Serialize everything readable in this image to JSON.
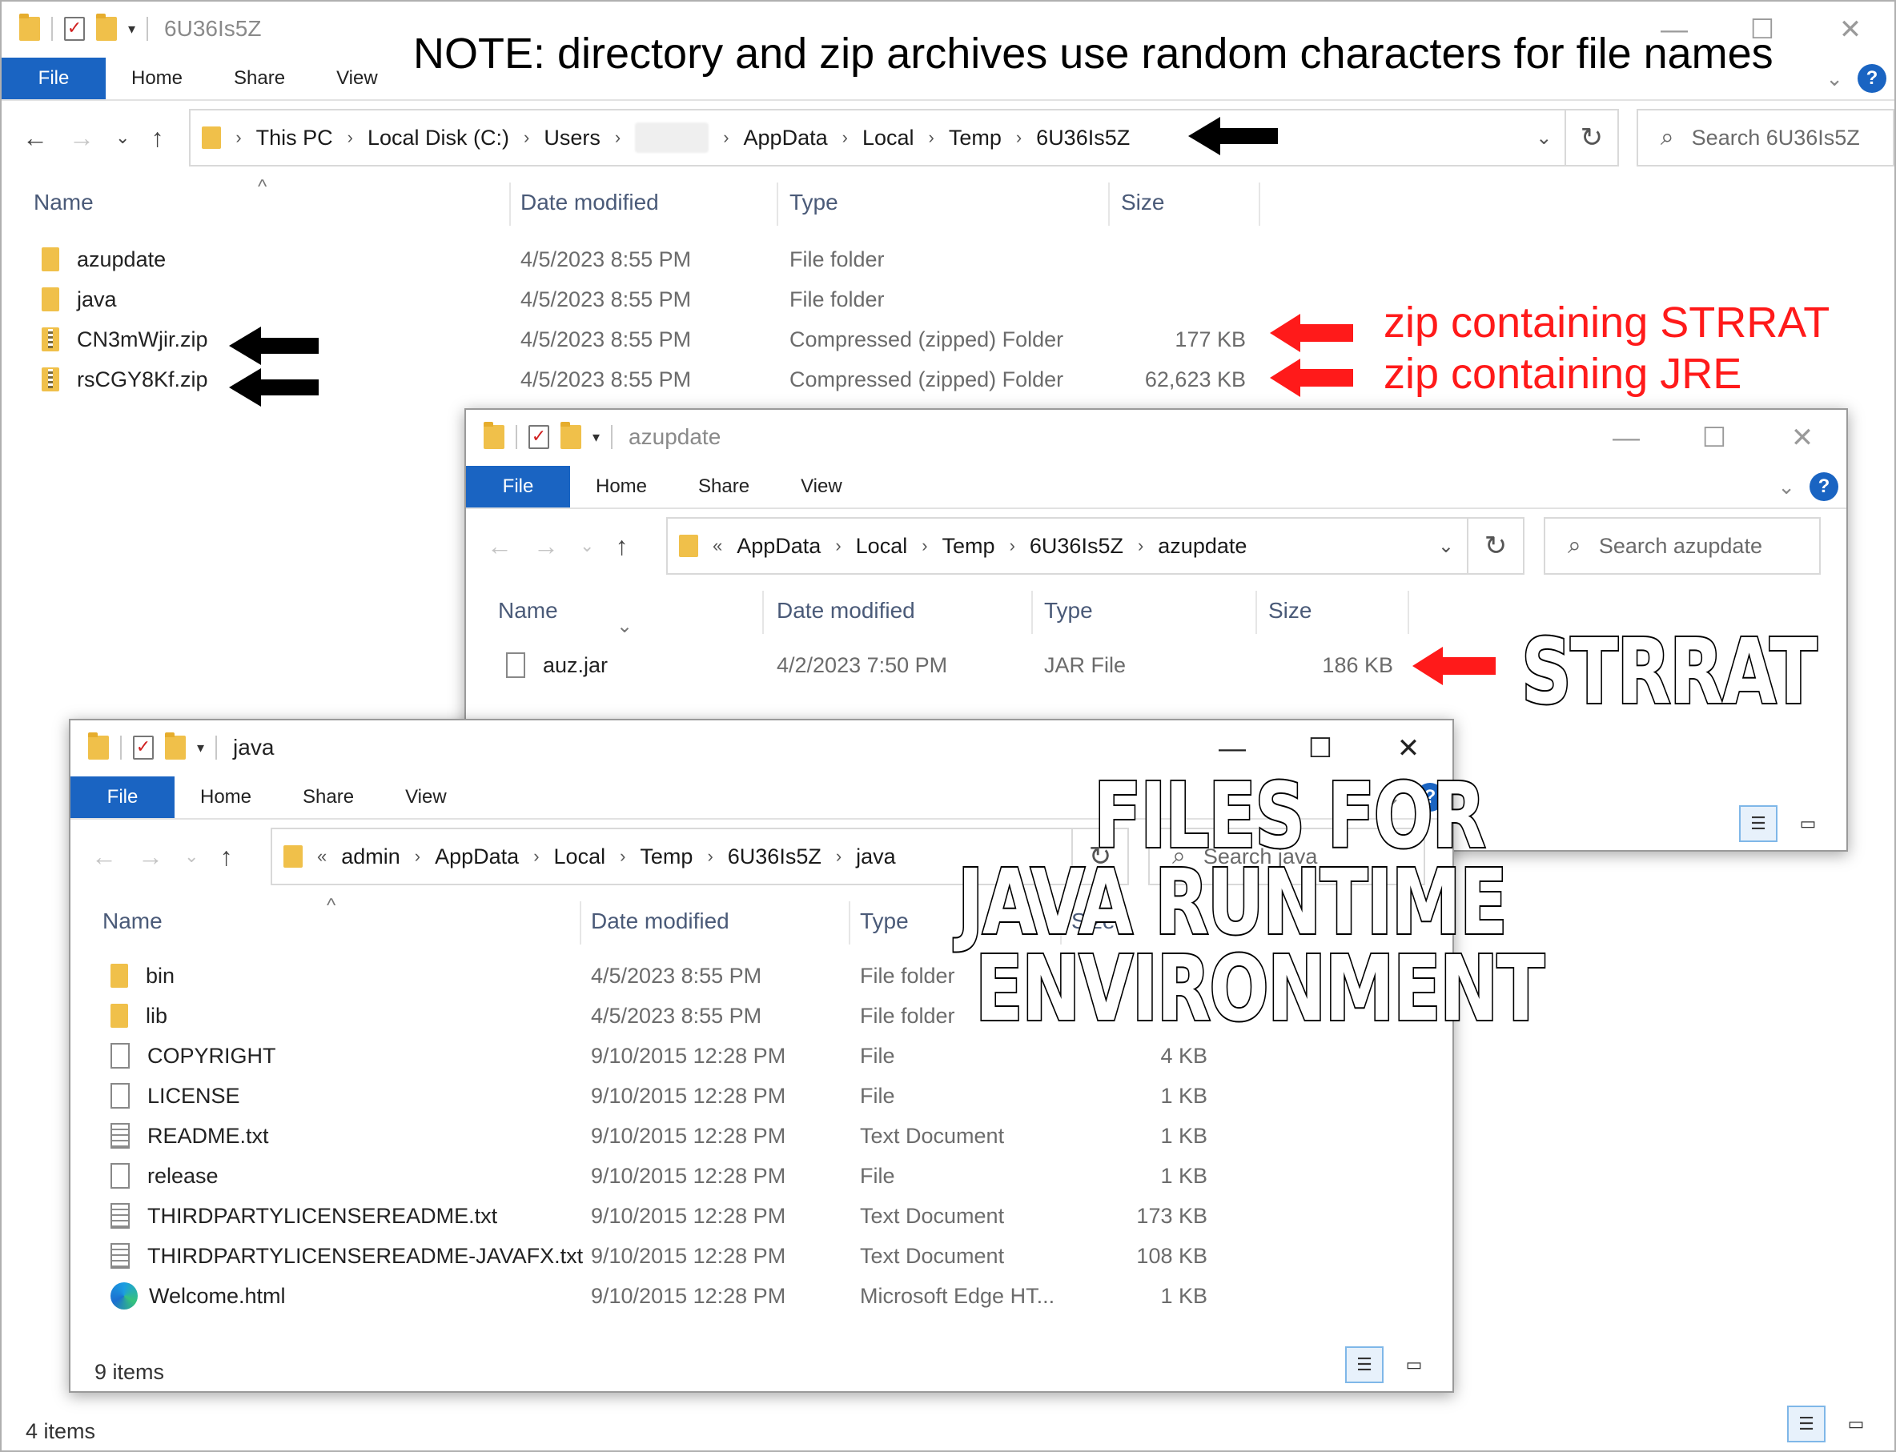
{
  "main": {
    "title": "6U36Is5Z",
    "tabs": [
      "File",
      "Home",
      "Share",
      "View"
    ],
    "breadcrumb": [
      "This PC",
      "Local Disk (C:)",
      "Users",
      "AppData",
      "Local",
      "Temp",
      "6U36Is5Z"
    ],
    "search_placeholder": "Search 6U36Is5Z",
    "columns": [
      "Name",
      "Date modified",
      "Type",
      "Size"
    ],
    "rows": [
      {
        "name": "azupdate",
        "date": "4/5/2023 8:55 PM",
        "type": "File folder",
        "size": ""
      },
      {
        "name": "java",
        "date": "4/5/2023 8:55 PM",
        "type": "File folder",
        "size": ""
      },
      {
        "name": "CN3mWjir.zip",
        "date": "4/5/2023 8:55 PM",
        "type": "Compressed (zipped) Folder",
        "size": "177 KB"
      },
      {
        "name": "rsCGY8Kf.zip",
        "date": "4/5/2023 8:55 PM",
        "type": "Compressed (zipped) Folder",
        "size": "62,623 KB"
      }
    ],
    "status": "4 items"
  },
  "azupdate": {
    "title": "azupdate",
    "tabs": [
      "File",
      "Home",
      "Share",
      "View"
    ],
    "breadcrumb_prefix": "«",
    "breadcrumb": [
      "AppData",
      "Local",
      "Temp",
      "6U36Is5Z",
      "azupdate"
    ],
    "search_placeholder": "Search azupdate",
    "columns": [
      "Name",
      "Date modified",
      "Type",
      "Size"
    ],
    "rows": [
      {
        "name": "auz.jar",
        "date": "4/2/2023 7:50 PM",
        "type": "JAR File",
        "size": "186 KB"
      }
    ]
  },
  "java": {
    "title": "java",
    "tabs": [
      "File",
      "Home",
      "Share",
      "View"
    ],
    "breadcrumb_prefix": "«",
    "breadcrumb": [
      "admin",
      "AppData",
      "Local",
      "Temp",
      "6U36Is5Z",
      "java"
    ],
    "search_placeholder": "Search java",
    "columns": [
      "Name",
      "Date modified",
      "Type",
      "Size"
    ],
    "rows": [
      {
        "name": "bin",
        "date": "4/5/2023 8:55 PM",
        "type": "File folder",
        "size": "",
        "icon": "folder-icon"
      },
      {
        "name": "lib",
        "date": "4/5/2023 8:55 PM",
        "type": "File folder",
        "size": "",
        "icon": "folder-icon"
      },
      {
        "name": "COPYRIGHT",
        "date": "9/10/2015 12:28 PM",
        "type": "File",
        "size": "4 KB",
        "icon": "file-icon"
      },
      {
        "name": "LICENSE",
        "date": "9/10/2015 12:28 PM",
        "type": "File",
        "size": "1 KB",
        "icon": "file-icon"
      },
      {
        "name": "README.txt",
        "date": "9/10/2015 12:28 PM",
        "type": "Text Document",
        "size": "1 KB",
        "icon": "text-file-icon"
      },
      {
        "name": "release",
        "date": "9/10/2015 12:28 PM",
        "type": "File",
        "size": "1 KB",
        "icon": "file-icon"
      },
      {
        "name": "THIRDPARTYLICENSEREADME.txt",
        "date": "9/10/2015 12:28 PM",
        "type": "Text Document",
        "size": "173 KB",
        "icon": "text-file-icon"
      },
      {
        "name": "THIRDPARTYLICENSEREADME-JAVAFX.txt",
        "date": "9/10/2015 12:28 PM",
        "type": "Text Document",
        "size": "108 KB",
        "icon": "text-file-icon"
      },
      {
        "name": "Welcome.html",
        "date": "9/10/2015 12:28 PM",
        "type": "Microsoft Edge HT...",
        "size": "1 KB",
        "icon": "edge-icon"
      }
    ],
    "status": "9 items"
  },
  "annotations": {
    "note": "NOTE: directory and zip archives use random characters for file names",
    "zip_strrat": "zip containing STRRAT",
    "zip_jre": "zip containing JRE",
    "strrat_label": "STRRAT",
    "jre_label_1": "FILES  FOR",
    "jre_label_2": "JAVA RUNTIME",
    "jre_label_3": "ENVIRONMENT",
    "red_color": "#ff1a1a"
  }
}
